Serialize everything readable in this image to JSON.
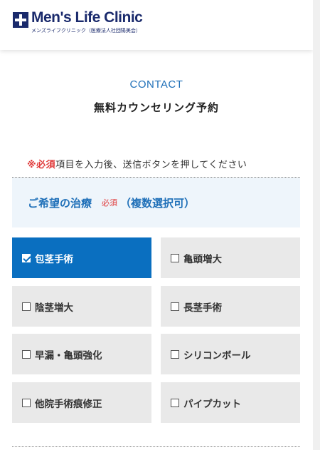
{
  "header": {
    "logo_title": "Men's Life Clinic",
    "logo_subtitle": "メンズライフクリニック（医療法人社団陽美会）"
  },
  "contact": {
    "label": "CONTACT",
    "title": "無料カウンセリング予約"
  },
  "notice": {
    "mark": "※必須",
    "text": "項目を入力後、送信ボタンを押してください"
  },
  "treatment_section": {
    "title": "ご希望の治療",
    "required": "必須",
    "note": "（複数選択可）"
  },
  "options": [
    {
      "label": "包茎手術",
      "checked": true
    },
    {
      "label": "亀頭増大",
      "checked": false
    },
    {
      "label": "陰茎増大",
      "checked": false
    },
    {
      "label": "長茎手術",
      "checked": false
    },
    {
      "label": "早漏・亀頭強化",
      "checked": false
    },
    {
      "label": "シリコンボール",
      "checked": false
    },
    {
      "label": "他院手術痕修正",
      "checked": false
    },
    {
      "label": "パイプカット",
      "checked": false
    }
  ],
  "colors": {
    "accent": "#1e6fb8",
    "selected": "#0a6fc0",
    "required": "#e03a3a",
    "brand": "#1a2a6c"
  }
}
